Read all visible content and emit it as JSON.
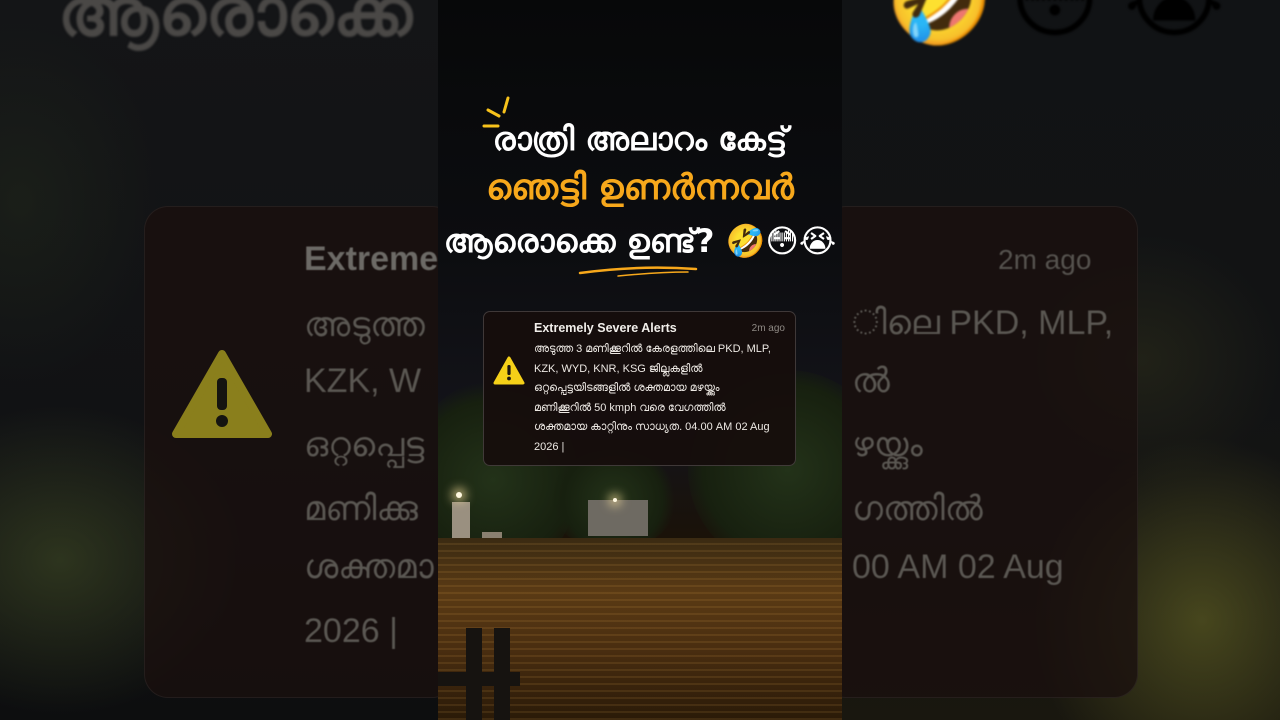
{
  "headline": {
    "line1": "രാത്രി അലാറം കേട്ട്",
    "line2": "ഞെട്ടി ഉണർന്നവർ",
    "line3": "ആരൊക്കെ ഉണ്ട്?",
    "emojis": "🤣😳😭"
  },
  "alert": {
    "title": "Extremely Severe Alerts",
    "time": "2m ago",
    "body": [
      "അടുത്ത 3 മണിക്കൂറിൽ കേരളത്തിലെ PKD, MLP,",
      "KZK, WYD, KNR, KSG ജില്ലകളിൽ",
      "ഒറ്റപ്പെട്ടയിടങ്ങളിൽ ശക്തമായ മഴയ്ക്കും",
      "മണിക്കൂറിൽ 50 kmph വരെ വേഗത്തിൽ",
      "ശക്തമായ കാറ്റിനും സാധ്യത. 04.00 AM 02 Aug",
      "2026 |"
    ],
    "icon": "warning-triangle-icon"
  },
  "background_left": {
    "top_text": "ആരൊക്കെ",
    "title": "Extreme",
    "lines": [
      "അടുത്ത",
      "KZK, W",
      "ഒറ്റപ്പെട്ട",
      "മണിക്കു",
      "ശക്തമാ",
      "2026 |"
    ]
  },
  "background_right": {
    "time": "2m ago",
    "emojis": [
      "🤣",
      "😳",
      "😭"
    ],
    "lines": [
      "ിലെ PKD, MLP,",
      "ൽ",
      "ഴയ്ക്കും",
      "ഗത്തിൽ",
      "00 AM 02 Aug"
    ]
  },
  "colors": {
    "accent": "#f7a81b",
    "warning": "#f5d018",
    "card_bg": "#160d0c"
  }
}
